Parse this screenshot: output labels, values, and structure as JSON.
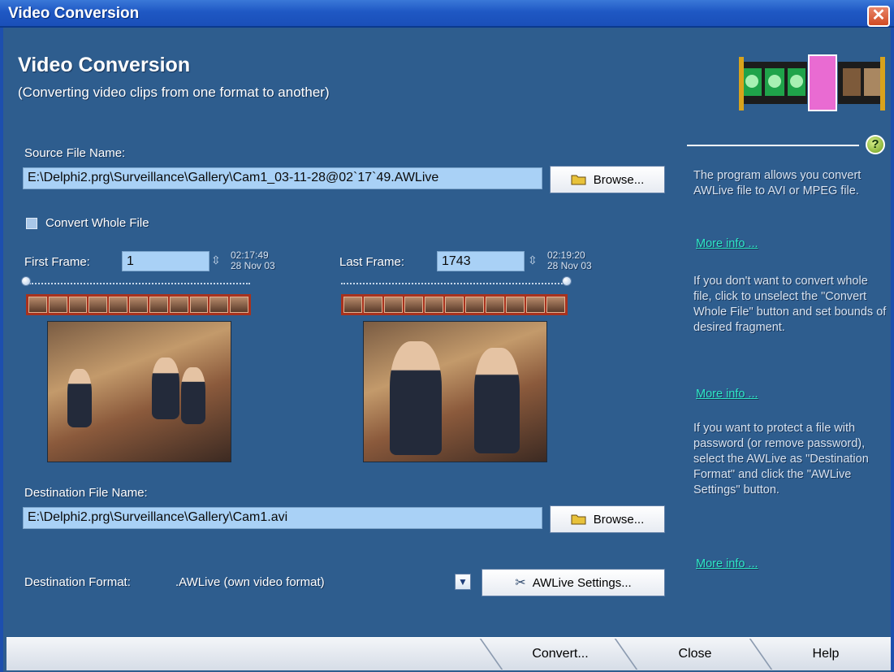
{
  "window": {
    "title": "Video Conversion",
    "close_glyph": "✕"
  },
  "header": {
    "title": "Video Conversion",
    "subtitle": "(Converting video clips from one format to another)"
  },
  "source": {
    "label": "Source File Name:",
    "value": "E:\\Delphi2.prg\\Surveillance\\Gallery\\Cam1_03-11-28@02`17`49.AWLive",
    "browse_label": "Browse..."
  },
  "convert_whole": {
    "label": "Convert Whole File",
    "checked": false
  },
  "first_frame": {
    "label": "First Frame:",
    "value": "1",
    "time": "02:17:49",
    "date": "28 Nov 03",
    "position": 0
  },
  "last_frame": {
    "label": "Last Frame:",
    "value": "1743",
    "time": "02:19:20",
    "date": "28 Nov 03",
    "position": 1
  },
  "destination": {
    "label": "Destination File Name:",
    "value": "E:\\Delphi2.prg\\Surveillance\\Gallery\\Cam1.avi",
    "browse_label": "Browse..."
  },
  "format": {
    "label": "Destination Format:",
    "value": ".AWLive (own video format)",
    "settings_label": "AWLive Settings..."
  },
  "help": {
    "p1": "The program allows you convert AWLive file to AVI or MPEG file.",
    "more1": "More info ...",
    "p2": "If you don't want to convert whole file, click to unselect the \"Convert Whole File\" button and set bounds of desired fragment.",
    "more2": "More info ...",
    "p3": "If you want to protect a file with password (or remove password), select the AWLive as \"Destination Format\" and click the \"AWLive Settings\" button.",
    "more3": "More info ..."
  },
  "bottom": {
    "convert_label": "Convert...",
    "close_label": "Close",
    "help_label": "Help"
  },
  "icons": {
    "folder": "folder-icon",
    "tools": "tools-icon",
    "help": "help-icon",
    "close": "close-icon"
  }
}
